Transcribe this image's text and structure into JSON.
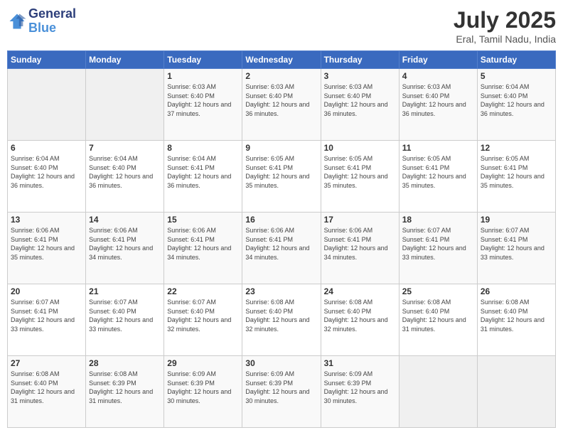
{
  "header": {
    "logo_line1": "General",
    "logo_line2": "Blue",
    "month_year": "July 2025",
    "location": "Eral, Tamil Nadu, India"
  },
  "weekdays": [
    "Sunday",
    "Monday",
    "Tuesday",
    "Wednesday",
    "Thursday",
    "Friday",
    "Saturday"
  ],
  "weeks": [
    [
      {
        "day": "",
        "sunrise": "",
        "sunset": "",
        "daylight": ""
      },
      {
        "day": "",
        "sunrise": "",
        "sunset": "",
        "daylight": ""
      },
      {
        "day": "1",
        "sunrise": "Sunrise: 6:03 AM",
        "sunset": "Sunset: 6:40 PM",
        "daylight": "Daylight: 12 hours and 37 minutes."
      },
      {
        "day": "2",
        "sunrise": "Sunrise: 6:03 AM",
        "sunset": "Sunset: 6:40 PM",
        "daylight": "Daylight: 12 hours and 36 minutes."
      },
      {
        "day": "3",
        "sunrise": "Sunrise: 6:03 AM",
        "sunset": "Sunset: 6:40 PM",
        "daylight": "Daylight: 12 hours and 36 minutes."
      },
      {
        "day": "4",
        "sunrise": "Sunrise: 6:03 AM",
        "sunset": "Sunset: 6:40 PM",
        "daylight": "Daylight: 12 hours and 36 minutes."
      },
      {
        "day": "5",
        "sunrise": "Sunrise: 6:04 AM",
        "sunset": "Sunset: 6:40 PM",
        "daylight": "Daylight: 12 hours and 36 minutes."
      }
    ],
    [
      {
        "day": "6",
        "sunrise": "Sunrise: 6:04 AM",
        "sunset": "Sunset: 6:40 PM",
        "daylight": "Daylight: 12 hours and 36 minutes."
      },
      {
        "day": "7",
        "sunrise": "Sunrise: 6:04 AM",
        "sunset": "Sunset: 6:40 PM",
        "daylight": "Daylight: 12 hours and 36 minutes."
      },
      {
        "day": "8",
        "sunrise": "Sunrise: 6:04 AM",
        "sunset": "Sunset: 6:41 PM",
        "daylight": "Daylight: 12 hours and 36 minutes."
      },
      {
        "day": "9",
        "sunrise": "Sunrise: 6:05 AM",
        "sunset": "Sunset: 6:41 PM",
        "daylight": "Daylight: 12 hours and 35 minutes."
      },
      {
        "day": "10",
        "sunrise": "Sunrise: 6:05 AM",
        "sunset": "Sunset: 6:41 PM",
        "daylight": "Daylight: 12 hours and 35 minutes."
      },
      {
        "day": "11",
        "sunrise": "Sunrise: 6:05 AM",
        "sunset": "Sunset: 6:41 PM",
        "daylight": "Daylight: 12 hours and 35 minutes."
      },
      {
        "day": "12",
        "sunrise": "Sunrise: 6:05 AM",
        "sunset": "Sunset: 6:41 PM",
        "daylight": "Daylight: 12 hours and 35 minutes."
      }
    ],
    [
      {
        "day": "13",
        "sunrise": "Sunrise: 6:06 AM",
        "sunset": "Sunset: 6:41 PM",
        "daylight": "Daylight: 12 hours and 35 minutes."
      },
      {
        "day": "14",
        "sunrise": "Sunrise: 6:06 AM",
        "sunset": "Sunset: 6:41 PM",
        "daylight": "Daylight: 12 hours and 34 minutes."
      },
      {
        "day": "15",
        "sunrise": "Sunrise: 6:06 AM",
        "sunset": "Sunset: 6:41 PM",
        "daylight": "Daylight: 12 hours and 34 minutes."
      },
      {
        "day": "16",
        "sunrise": "Sunrise: 6:06 AM",
        "sunset": "Sunset: 6:41 PM",
        "daylight": "Daylight: 12 hours and 34 minutes."
      },
      {
        "day": "17",
        "sunrise": "Sunrise: 6:06 AM",
        "sunset": "Sunset: 6:41 PM",
        "daylight": "Daylight: 12 hours and 34 minutes."
      },
      {
        "day": "18",
        "sunrise": "Sunrise: 6:07 AM",
        "sunset": "Sunset: 6:41 PM",
        "daylight": "Daylight: 12 hours and 33 minutes."
      },
      {
        "day": "19",
        "sunrise": "Sunrise: 6:07 AM",
        "sunset": "Sunset: 6:41 PM",
        "daylight": "Daylight: 12 hours and 33 minutes."
      }
    ],
    [
      {
        "day": "20",
        "sunrise": "Sunrise: 6:07 AM",
        "sunset": "Sunset: 6:41 PM",
        "daylight": "Daylight: 12 hours and 33 minutes."
      },
      {
        "day": "21",
        "sunrise": "Sunrise: 6:07 AM",
        "sunset": "Sunset: 6:40 PM",
        "daylight": "Daylight: 12 hours and 33 minutes."
      },
      {
        "day": "22",
        "sunrise": "Sunrise: 6:07 AM",
        "sunset": "Sunset: 6:40 PM",
        "daylight": "Daylight: 12 hours and 32 minutes."
      },
      {
        "day": "23",
        "sunrise": "Sunrise: 6:08 AM",
        "sunset": "Sunset: 6:40 PM",
        "daylight": "Daylight: 12 hours and 32 minutes."
      },
      {
        "day": "24",
        "sunrise": "Sunrise: 6:08 AM",
        "sunset": "Sunset: 6:40 PM",
        "daylight": "Daylight: 12 hours and 32 minutes."
      },
      {
        "day": "25",
        "sunrise": "Sunrise: 6:08 AM",
        "sunset": "Sunset: 6:40 PM",
        "daylight": "Daylight: 12 hours and 31 minutes."
      },
      {
        "day": "26",
        "sunrise": "Sunrise: 6:08 AM",
        "sunset": "Sunset: 6:40 PM",
        "daylight": "Daylight: 12 hours and 31 minutes."
      }
    ],
    [
      {
        "day": "27",
        "sunrise": "Sunrise: 6:08 AM",
        "sunset": "Sunset: 6:40 PM",
        "daylight": "Daylight: 12 hours and 31 minutes."
      },
      {
        "day": "28",
        "sunrise": "Sunrise: 6:08 AM",
        "sunset": "Sunset: 6:39 PM",
        "daylight": "Daylight: 12 hours and 31 minutes."
      },
      {
        "day": "29",
        "sunrise": "Sunrise: 6:09 AM",
        "sunset": "Sunset: 6:39 PM",
        "daylight": "Daylight: 12 hours and 30 minutes."
      },
      {
        "day": "30",
        "sunrise": "Sunrise: 6:09 AM",
        "sunset": "Sunset: 6:39 PM",
        "daylight": "Daylight: 12 hours and 30 minutes."
      },
      {
        "day": "31",
        "sunrise": "Sunrise: 6:09 AM",
        "sunset": "Sunset: 6:39 PM",
        "daylight": "Daylight: 12 hours and 30 minutes."
      },
      {
        "day": "",
        "sunrise": "",
        "sunset": "",
        "daylight": ""
      },
      {
        "day": "",
        "sunrise": "",
        "sunset": "",
        "daylight": ""
      }
    ]
  ]
}
